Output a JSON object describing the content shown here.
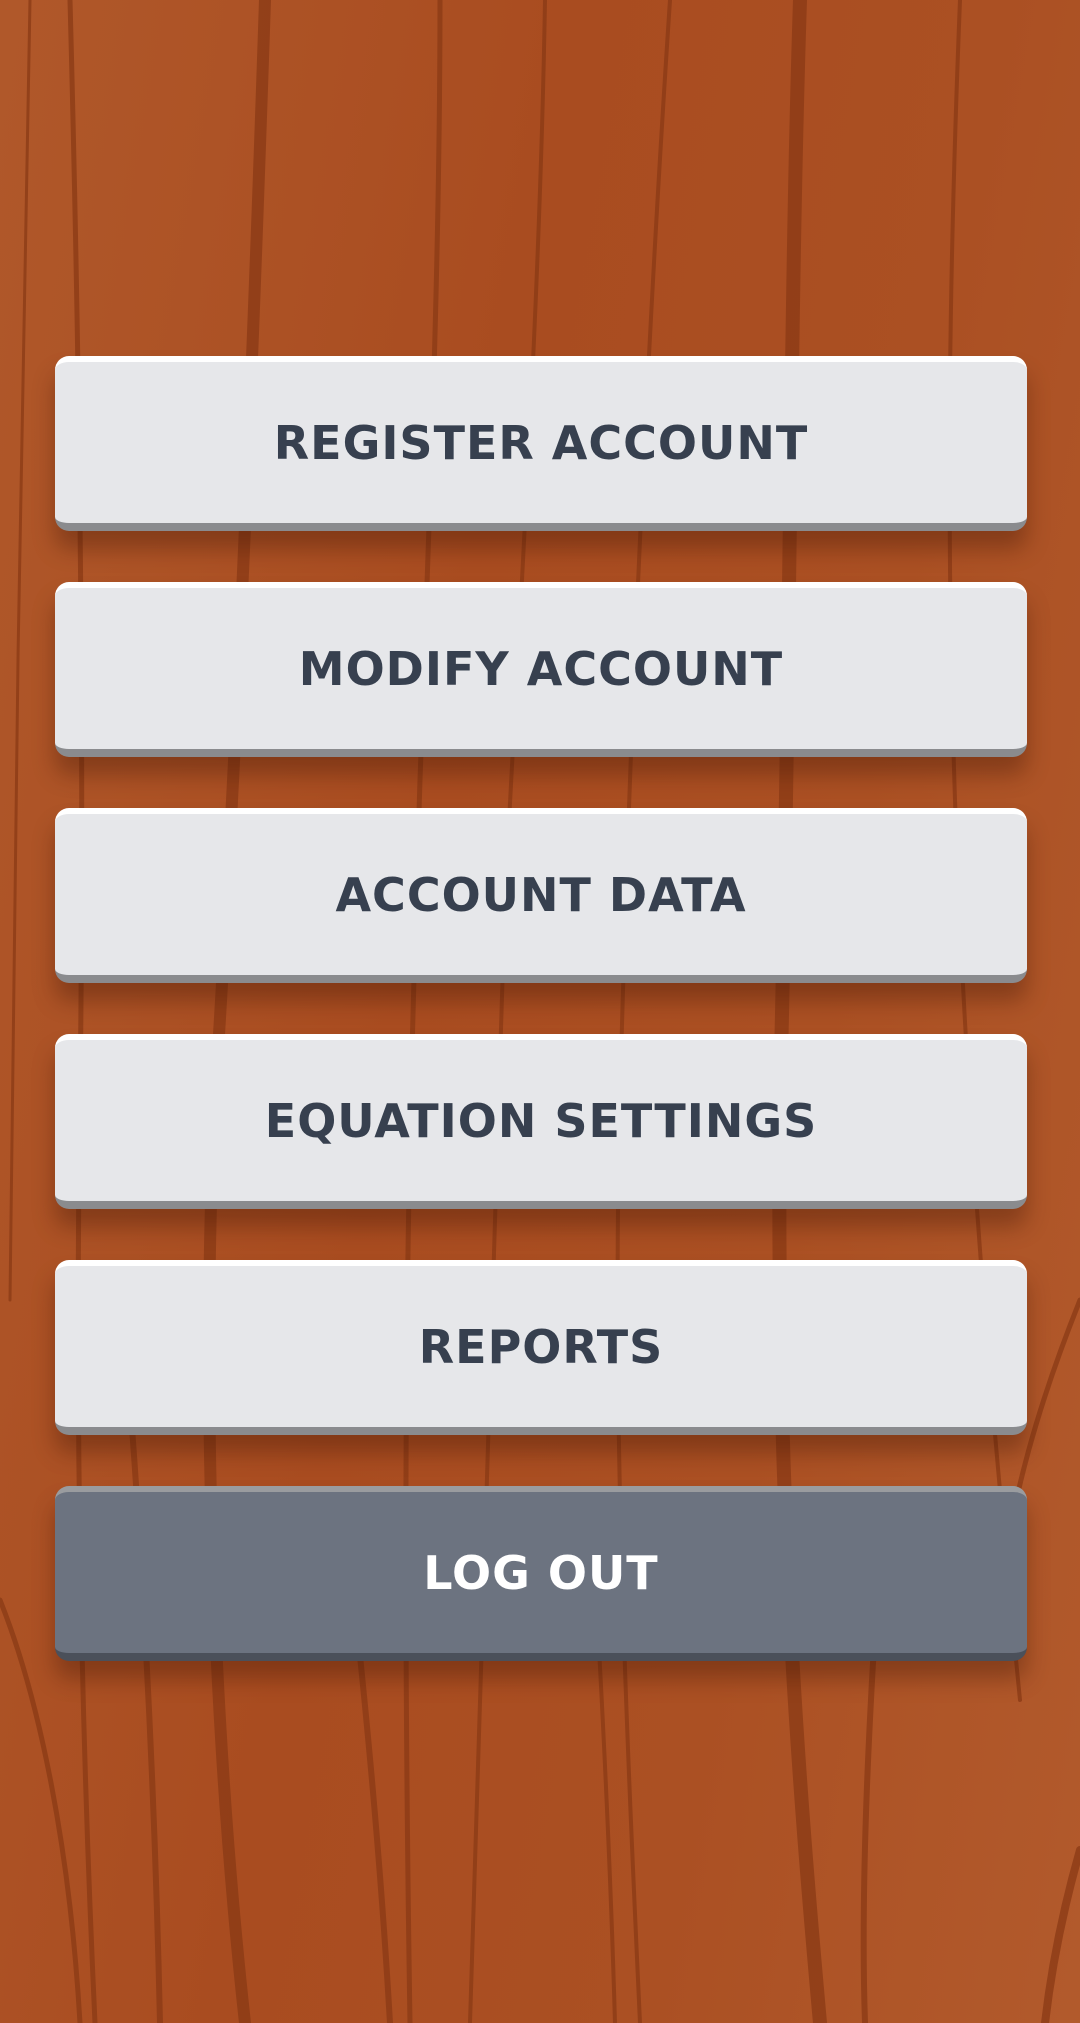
{
  "menu": {
    "register_account": "REGISTER ACCOUNT",
    "modify_account": "MODIFY ACCOUNT",
    "account_data": "ACCOUNT DATA",
    "equation_settings": "EQUATION SETTINGS",
    "reports": "REPORTS",
    "log_out": "LOG OUT"
  },
  "colors": {
    "background": "#ab5023",
    "button_light": "#e6e7ea",
    "button_light_text": "#37404f",
    "button_dark": "#6c7380",
    "button_dark_text": "#ffffff"
  }
}
